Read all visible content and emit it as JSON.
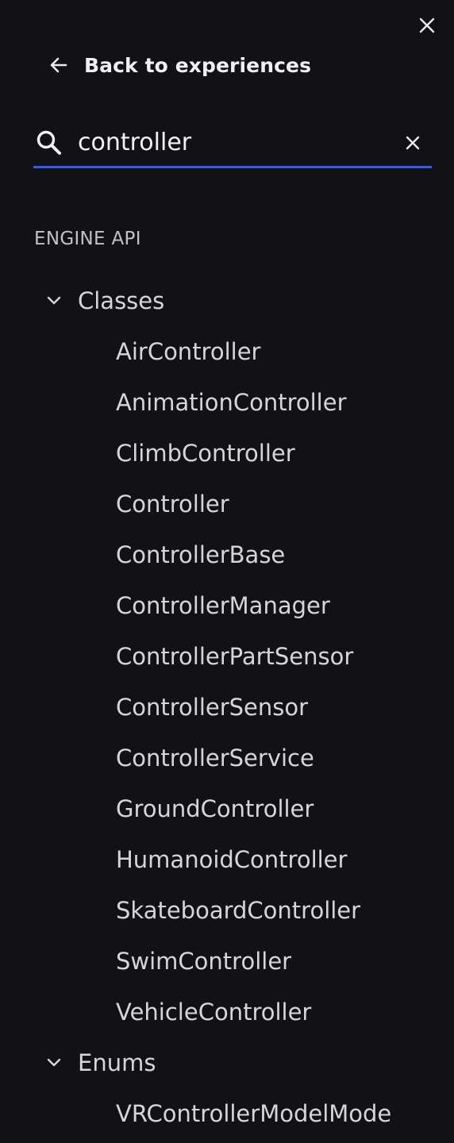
{
  "header": {
    "close_icon": "close-icon",
    "back_label": "Back to experiences",
    "back_icon": "arrow-left-icon"
  },
  "search": {
    "value": "controller",
    "icon": "search-icon",
    "clear_icon": "close-icon",
    "accent_color": "#2f5cf0"
  },
  "section": {
    "label": "ENGINE API"
  },
  "tree": {
    "groups": [
      {
        "label": "Classes",
        "expanded": true,
        "items": [
          "AirController",
          "AnimationController",
          "ClimbController",
          "Controller",
          "ControllerBase",
          "ControllerManager",
          "ControllerPartSensor",
          "ControllerSensor",
          "ControllerService",
          "GroundController",
          "HumanoidController",
          "SkateboardController",
          "SwimController",
          "VehicleController"
        ]
      },
      {
        "label": "Enums",
        "expanded": true,
        "items": [
          "VRControllerModelMode"
        ]
      }
    ]
  },
  "colors": {
    "background": "#121215",
    "text": "#d4d6da"
  }
}
